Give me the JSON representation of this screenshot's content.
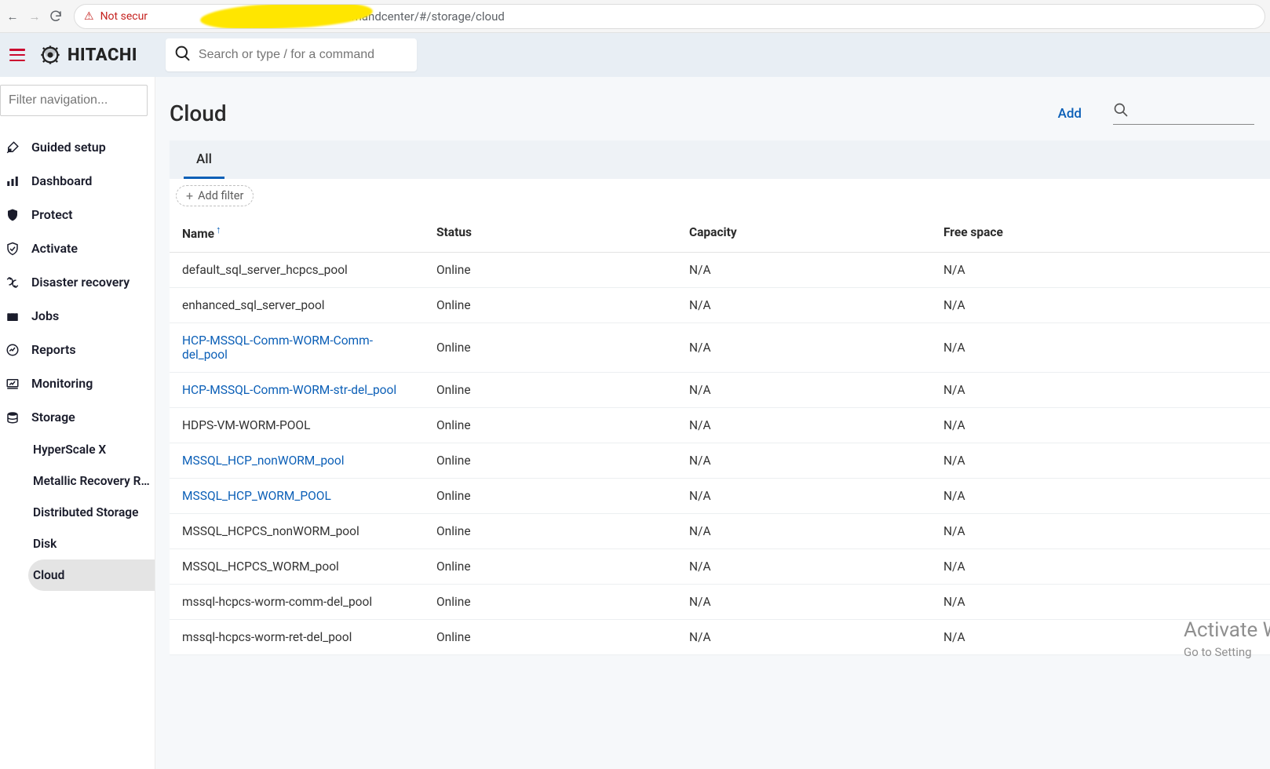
{
  "browser": {
    "not_secure_label": "Not secur",
    "url_tail": "ommandcenter/#/storage/cloud"
  },
  "header": {
    "brand": "HITACHI",
    "search_placeholder": "Search or type / for a command"
  },
  "sidebar": {
    "filter_placeholder": "Filter navigation...",
    "items": [
      {
        "label": "Guided setup"
      },
      {
        "label": "Dashboard"
      },
      {
        "label": "Protect"
      },
      {
        "label": "Activate"
      },
      {
        "label": "Disaster recovery"
      },
      {
        "label": "Jobs"
      },
      {
        "label": "Reports"
      },
      {
        "label": "Monitoring"
      },
      {
        "label": "Storage"
      }
    ],
    "storage_children": [
      {
        "label": "HyperScale X"
      },
      {
        "label": "Metallic Recovery R..."
      },
      {
        "label": "Distributed Storage"
      },
      {
        "label": "Disk"
      },
      {
        "label": "Cloud",
        "active": true
      }
    ]
  },
  "page": {
    "title": "Cloud",
    "add_label": "Add",
    "tab_all": "All",
    "add_filter": "Add filter",
    "columns": {
      "name": "Name",
      "status": "Status",
      "capacity": "Capacity",
      "free": "Free space"
    },
    "rows": [
      {
        "name": "default_sql_server_hcpcs_pool",
        "link": false,
        "status": "Online",
        "capacity": "N/A",
        "free": "N/A"
      },
      {
        "name": "enhanced_sql_server_pool",
        "link": false,
        "status": "Online",
        "capacity": "N/A",
        "free": "N/A"
      },
      {
        "name": "HCP-MSSQL-Comm-WORM-Comm-del_pool",
        "link": true,
        "status": "Online",
        "capacity": "N/A",
        "free": "N/A"
      },
      {
        "name": "HCP-MSSQL-Comm-WORM-str-del_pool",
        "link": true,
        "status": "Online",
        "capacity": "N/A",
        "free": "N/A"
      },
      {
        "name": "HDPS-VM-WORM-POOL",
        "link": false,
        "status": "Online",
        "capacity": "N/A",
        "free": "N/A"
      },
      {
        "name": "MSSQL_HCP_nonWORM_pool",
        "link": true,
        "status": "Online",
        "capacity": "N/A",
        "free": "N/A"
      },
      {
        "name": "MSSQL_HCP_WORM_POOL",
        "link": true,
        "status": "Online",
        "capacity": "N/A",
        "free": "N/A"
      },
      {
        "name": "MSSQL_HCPCS_nonWORM_pool",
        "link": false,
        "status": "Online",
        "capacity": "N/A",
        "free": "N/A"
      },
      {
        "name": "MSSQL_HCPCS_WORM_pool",
        "link": false,
        "status": "Online",
        "capacity": "N/A",
        "free": "N/A"
      },
      {
        "name": "mssql-hcpcs-worm-comm-del_pool",
        "link": false,
        "status": "Online",
        "capacity": "N/A",
        "free": "N/A"
      },
      {
        "name": "mssql-hcpcs-worm-ret-del_pool",
        "link": false,
        "status": "Online",
        "capacity": "N/A",
        "free": "N/A"
      }
    ]
  },
  "watermark": {
    "l1": "Activate W",
    "l2": "Go to Setting"
  }
}
